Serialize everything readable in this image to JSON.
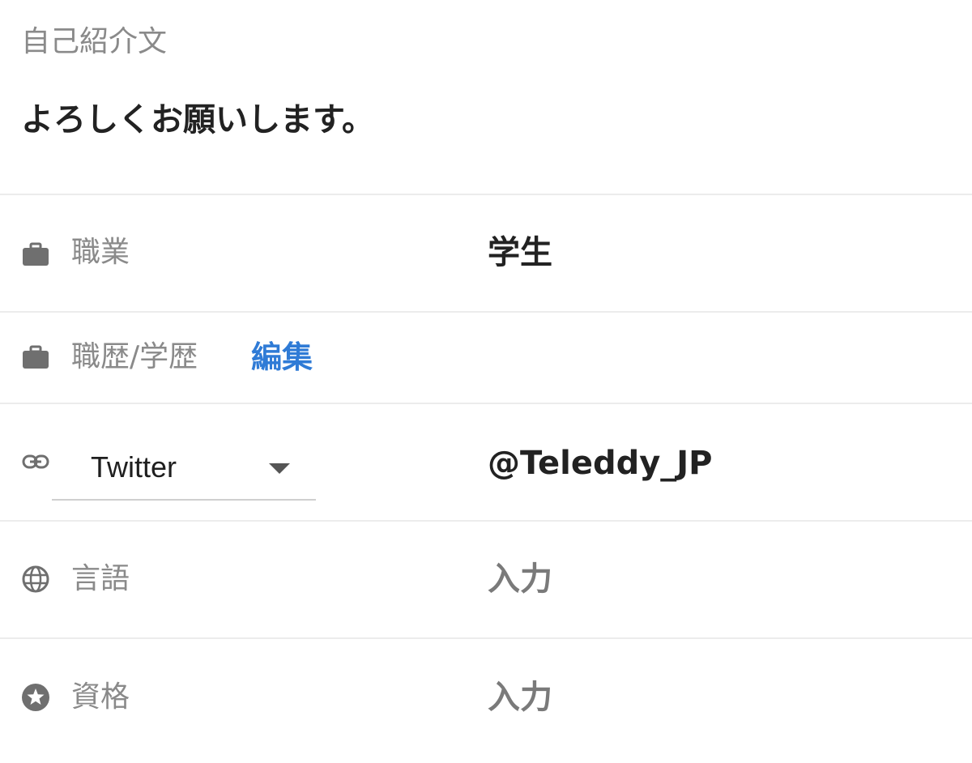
{
  "bio": {
    "label": "自己紹介文",
    "text": "よろしくお願いします。"
  },
  "rows": {
    "occupation": {
      "icon": "briefcase-icon",
      "label": "職業",
      "value": "学生"
    },
    "career": {
      "icon": "briefcase-icon",
      "label": "職歴/学歴",
      "edit_label": "編集"
    },
    "link": {
      "icon": "link-icon",
      "selected_service": "Twitter",
      "value": "@Teleddy_JP"
    },
    "language": {
      "icon": "globe-icon",
      "label": "言語",
      "placeholder": "入力"
    },
    "qualification": {
      "icon": "star-circle-icon",
      "label": "資格",
      "placeholder": "入力"
    }
  },
  "colors": {
    "label": "#8a8a8a",
    "text": "#222222",
    "link": "#2f7bd6",
    "icon": "#6f6f6f",
    "divider": "#ececec"
  }
}
